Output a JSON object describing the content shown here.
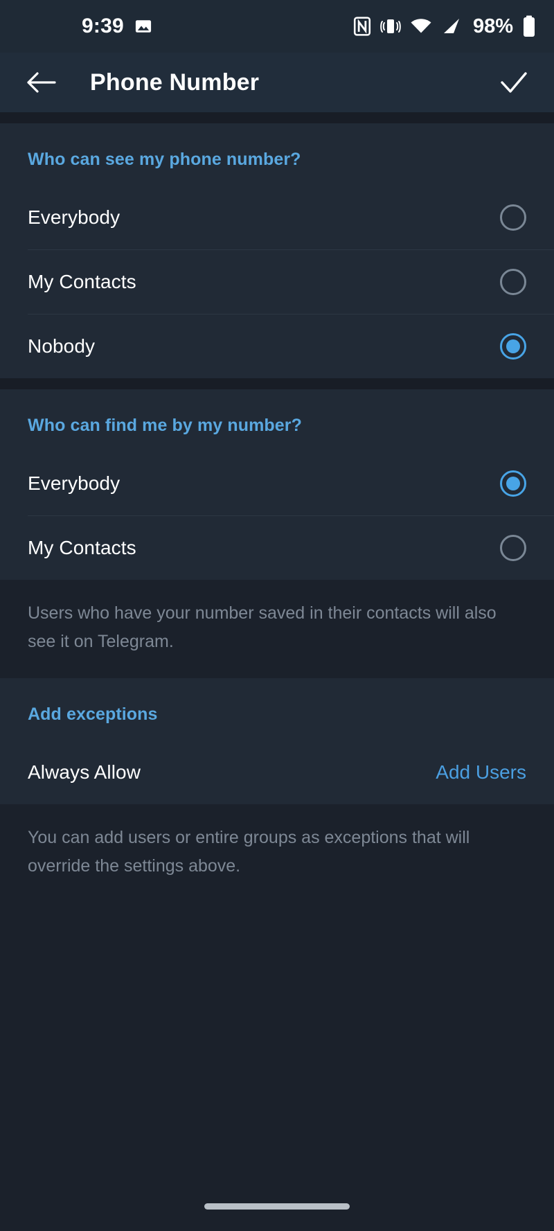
{
  "status_bar": {
    "time": "9:39",
    "battery_percent": "98%",
    "icons": [
      "photo-icon",
      "nfc-icon",
      "vibrate-icon",
      "wifi-icon",
      "cellular-signal-icon",
      "battery-icon"
    ]
  },
  "toolbar": {
    "title": "Phone Number",
    "back_icon": "arrow-left-icon",
    "done_icon": "checkmark-icon"
  },
  "colors": {
    "accent_blue": "#5aa8e0",
    "link_blue": "#4b9fe1",
    "radio_selected": "#48a4e6",
    "card_bg": "#212a36",
    "page_bg": "#181d26",
    "toolbar_bg": "#212d3b",
    "status_bg": "#1f2a36",
    "primary_text": "#ffffff",
    "secondary_text": "#7e8895",
    "divider": "#2c3744"
  },
  "sections": [
    {
      "header": "Who can see my phone number?",
      "options": [
        {
          "label": "Everybody",
          "selected": false
        },
        {
          "label": "My Contacts",
          "selected": false
        },
        {
          "label": "Nobody",
          "selected": true
        }
      ],
      "footer": ""
    },
    {
      "header": "Who can find me by my number?",
      "options": [
        {
          "label": "Everybody",
          "selected": true
        },
        {
          "label": "My Contacts",
          "selected": false
        }
      ],
      "footer": "Users who have your number saved in their contacts will also see it on Telegram."
    }
  ],
  "exceptions": {
    "header": "Add exceptions",
    "row_label": "Always Allow",
    "row_action": "Add Users",
    "footer": "You can add users or entire groups as exceptions that will override the settings above."
  },
  "navigation_bar": {
    "home_indicator": "home-gesture-pill"
  }
}
